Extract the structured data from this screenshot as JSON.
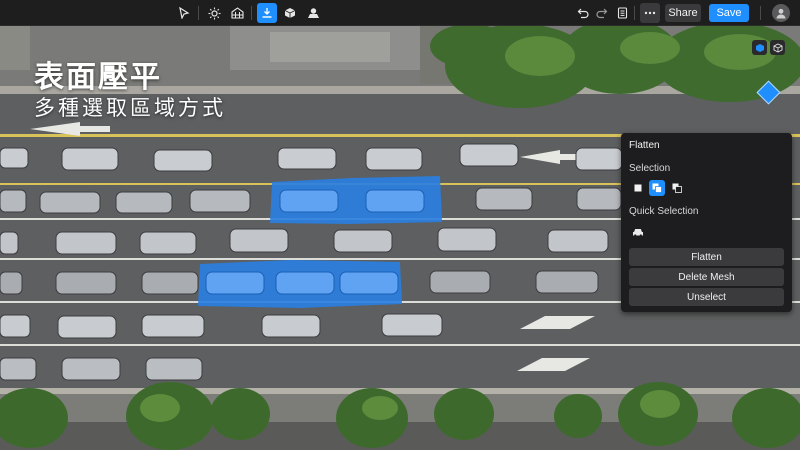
{
  "overlay": {
    "title": "表面壓平",
    "subtitle": "多種選取區域方式"
  },
  "toolbar": {
    "tools": [
      {
        "name": "select-cursor-icon",
        "active": false
      },
      {
        "name": "sun-icon",
        "active": false
      },
      {
        "name": "texture-grid-icon",
        "active": false
      },
      {
        "name": "flatten-icon",
        "active": true
      },
      {
        "name": "cube-icon",
        "active": false
      },
      {
        "name": "mesh-tool-icon",
        "active": false
      }
    ],
    "share_label": "Share",
    "save_label": "Save"
  },
  "panel": {
    "title": "Flatten",
    "selection_label": "Selection",
    "quick_selection_label": "Quick Selection",
    "selection_modes": [
      {
        "name": "rectangle-select-icon",
        "active": false
      },
      {
        "name": "brush-select-icon",
        "active": true
      },
      {
        "name": "subtract-select-icon",
        "active": false
      }
    ],
    "buttons": {
      "flatten": "Flatten",
      "delete_mesh": "Delete Mesh",
      "unselect": "Unselect"
    }
  },
  "colors": {
    "accent": "#1f8fff",
    "toolbar_bg": "#1e1e1f",
    "panel_bg": "#1d1d1f",
    "selection_highlight": "#2a7fe0"
  }
}
